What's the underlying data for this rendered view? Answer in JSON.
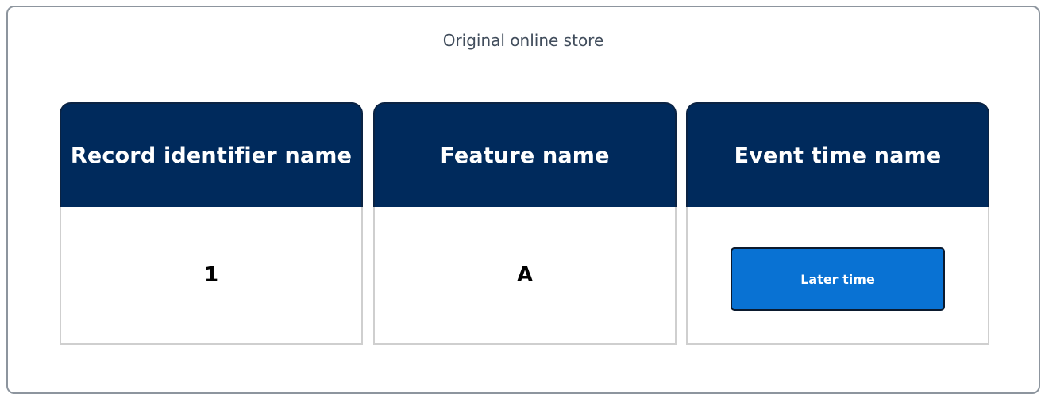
{
  "panel": {
    "title": "Original online store"
  },
  "columns": [
    {
      "header": "Record identifier name",
      "value": "1"
    },
    {
      "header": "Feature name",
      "value": "A"
    },
    {
      "header": "Event time name",
      "value": "Later time"
    }
  ],
  "colors": {
    "header_bg": "#002a5c",
    "button_bg": "#0972d3",
    "panel_border": "#8d959e"
  }
}
